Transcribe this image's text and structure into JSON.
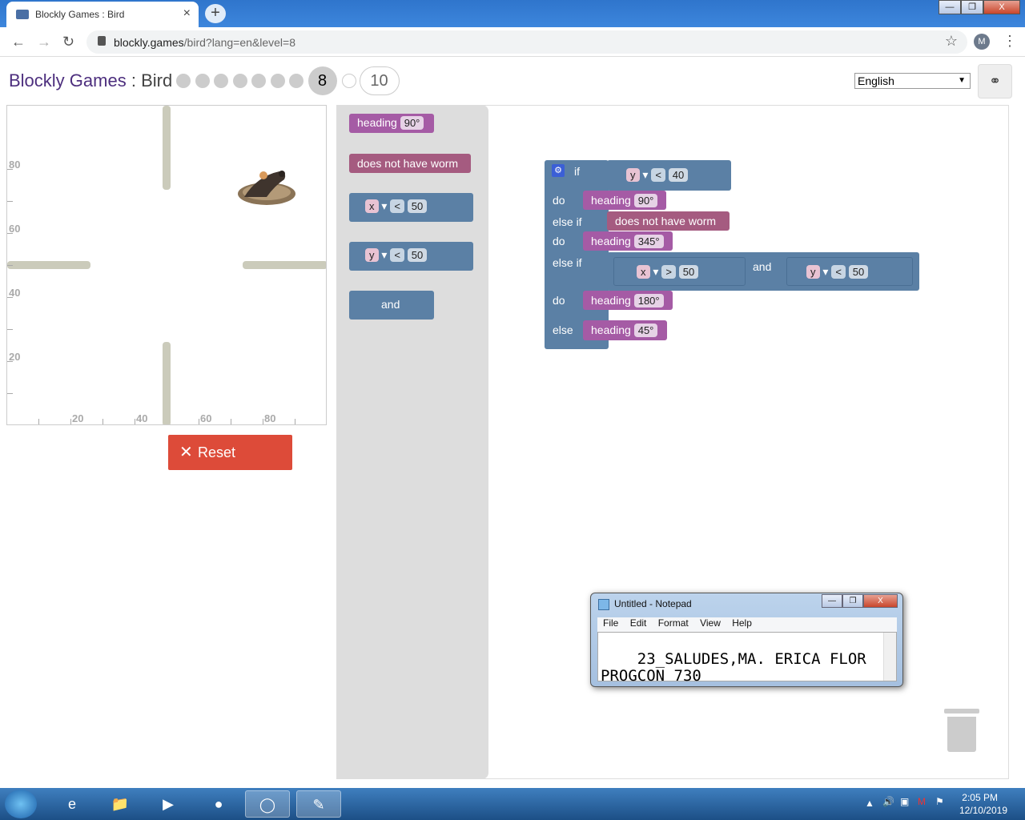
{
  "browser": {
    "tab_title": "Blockly Games : Bird",
    "tab_close": "×",
    "new_tab": "+",
    "url_host": "blockly.games",
    "url_path": "/bird?lang=en&level=8",
    "avatar_letter": "M",
    "window_minimize": "—",
    "window_restore": "❐",
    "window_close": "X"
  },
  "page": {
    "brand": "Blockly Games",
    "separator": " : ",
    "game": "Bird",
    "current_level": "8",
    "last_level": "10",
    "language": "English"
  },
  "viz": {
    "y_labels": [
      "80",
      "60",
      "40",
      "20"
    ],
    "x_labels": [
      "20",
      "40",
      "60",
      "80"
    ]
  },
  "reset_label": "Reset",
  "flyout": {
    "heading_label": "heading",
    "heading_value": "90°",
    "worm_label": "does not have worm",
    "cmp1_var": "x",
    "cmp1_op": "<",
    "cmp1_val": "50",
    "cmp2_var": "y",
    "cmp2_op": "<",
    "cmp2_val": "50",
    "and_label": "and"
  },
  "program": {
    "if_label": "if",
    "cond1_var": "y",
    "cond1_op": "<",
    "cond1_val": "40",
    "do_label": "do",
    "do1_heading": "heading",
    "do1_value": "90°",
    "elseif_label": "else if",
    "cond2_label": "does not have worm",
    "do2_heading": "heading",
    "do2_value": "345°",
    "cond3_a_var": "x",
    "cond3_a_op": ">",
    "cond3_a_val": "50",
    "cond3_and": "and",
    "cond3_b_var": "y",
    "cond3_b_op": "<",
    "cond3_b_val": "50",
    "do3_heading": "heading",
    "do3_value": "180°",
    "else_label": "else",
    "else_heading": "heading",
    "else_value": "45°"
  },
  "notepad": {
    "title": "Untitled - Notepad",
    "menu": [
      "File",
      "Edit",
      "Format",
      "View",
      "Help"
    ],
    "text": "23_SALUDES,MA. ERICA FLOR PROGCON 730"
  },
  "taskbar": {
    "time": "2:05 PM",
    "date": "12/10/2019"
  },
  "colors": {
    "logic_block": "#5b80a5",
    "heading_block": "#a55ba5",
    "sensor_block": "#a55b80",
    "reset_button": "#dd4b39",
    "brand": "#4d2f7e"
  }
}
